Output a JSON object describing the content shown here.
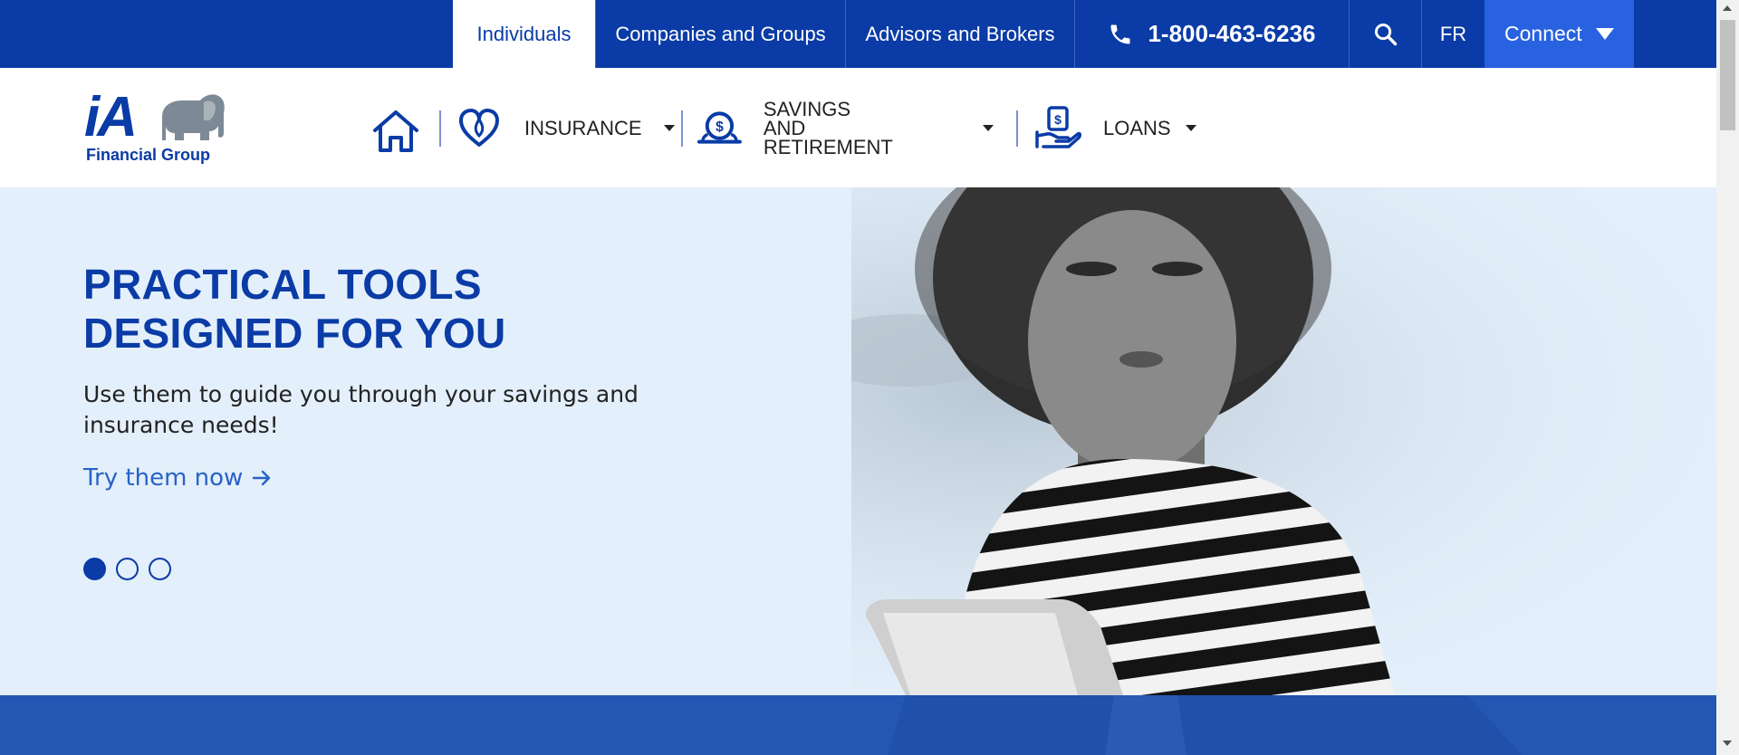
{
  "topnav": {
    "individuals": "Individuals",
    "companies": "Companies and Groups",
    "advisors": "Advisors and Brokers",
    "phone": "1-800-463-6236",
    "lang": "FR",
    "connect": "Connect"
  },
  "logo": {
    "mark": "iA",
    "text": "Financial Group"
  },
  "mainnav": {
    "insurance": "INSURANCE",
    "savings_line1": "SAVINGS AND",
    "savings_line2": "RETIREMENT",
    "loans": "LOANS"
  },
  "hero": {
    "title_line1": "PRACTICAL TOOLS",
    "title_line2": "DESIGNED FOR YOU",
    "subtitle": "Use them to guide you through your savings and insurance needs!",
    "link": "Try them now",
    "slides_total": 3,
    "active_slide": 1
  },
  "colors": {
    "brand_blue": "#0a3ba6",
    "accent_blue": "#2862e0",
    "link_blue": "#2862c8",
    "hero_bg": "#e3effa"
  }
}
